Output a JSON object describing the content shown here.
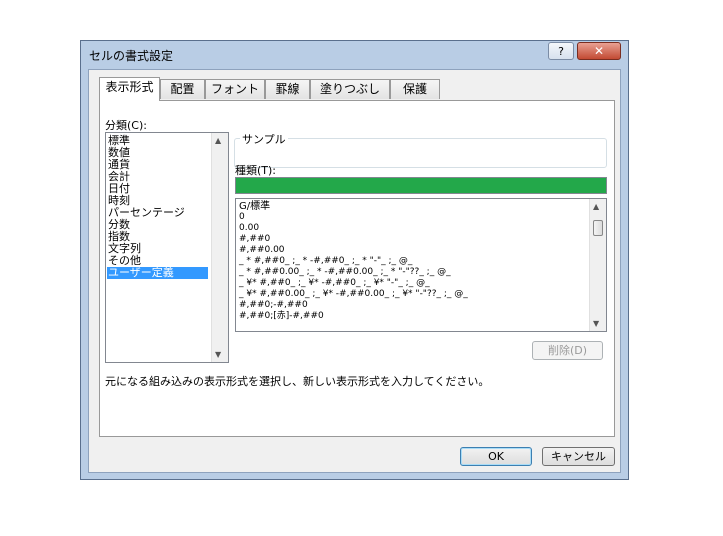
{
  "window": {
    "title": "セルの書式設定",
    "help": "?",
    "close": "✕"
  },
  "tabs": [
    "表示形式",
    "配置",
    "フォント",
    "罫線",
    "塗りつぶし",
    "保護"
  ],
  "category": {
    "label": "分類(C):",
    "items": [
      "標準",
      "数値",
      "通貨",
      "会計",
      "日付",
      "時刻",
      "パーセンテージ",
      "分数",
      "指数",
      "文字列",
      "その他",
      "ユーザー定義"
    ],
    "selected": "ユーザー定義"
  },
  "sample": {
    "label": "サンプル",
    "value": ""
  },
  "type": {
    "label": "種類(T):",
    "input_value": "",
    "formats": [
      "G/標準",
      "0",
      "0.00",
      "#,##0",
      "#,##0.00",
      "_ * #,##0_ ;_ * -#,##0_ ;_ * \"-\"_ ;_ @_",
      "_ * #,##0.00_ ;_ * -#,##0.00_ ;_ * \"-\"??_ ;_ @_",
      "_ ¥* #,##0_ ;_ ¥* -#,##0_ ;_ ¥* \"-\"_ ;_ @_",
      "_ ¥* #,##0.00_ ;_ ¥* -#,##0.00_ ;_ ¥* \"-\"??_ ;_ @_",
      "#,##0;-#,##0",
      "#,##0;[赤]-#,##0"
    ]
  },
  "delete_button": "削除(D)",
  "description": "元になる組み込みの表示形式を選択し、新しい表示形式を入力してください。",
  "ok_button": "OK",
  "cancel_button": "キャンセル"
}
